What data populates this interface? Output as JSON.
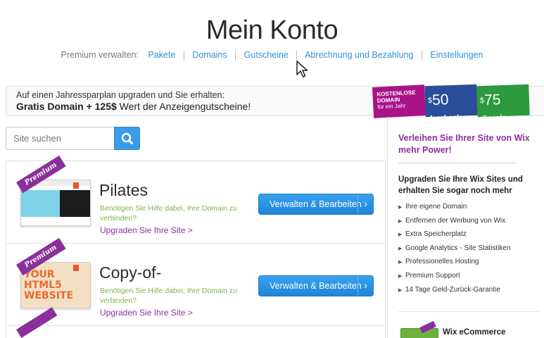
{
  "page": {
    "title": "Mein Konto"
  },
  "subnav": {
    "lead": "Premium verwalten:",
    "items": [
      "Pakete",
      "Domains",
      "Gutscheine",
      "Abrechnung und Bezahlung",
      "Einstellungen"
    ]
  },
  "promo": {
    "line1": "Auf einen Jahressparplan upgraden und Sie erhalten:",
    "line2_bold": "Gratis Domain + 125$",
    "line2_rest": " Wert der Anzeigengutscheine!",
    "badges": {
      "domain": [
        "KOSTENLOSE",
        "DOMAIN",
        "für ein Jahr"
      ],
      "facebook": {
        "amount": "50",
        "brand": "facebook",
        "label": "Ads"
      },
      "google": {
        "amount": "75",
        "brand": "Google",
        "label": "AdWords"
      }
    }
  },
  "search": {
    "placeholder": "Site suchen"
  },
  "sites": [
    {
      "name": "Pilates",
      "help": "Benötigen Sie Hilfe dabei, Ihre Domain zu verbinden?",
      "upgrade": "Upgraden Sie Ihre Site >",
      "button": "Verwalten & Bearbeiten",
      "ribbon": "Premium"
    },
    {
      "name": "Copy-of-",
      "help": "Benötigen Sie Hilfe dabei, Ihre Domain zu verbinden?",
      "upgrade": "Upgraden Sie Ihre Site >",
      "button": "Verwalten & Bearbeiten",
      "ribbon": "Premium",
      "thumb_text": [
        "YOUR",
        "HTML5",
        "WEBSITE"
      ]
    }
  ],
  "sidebar": {
    "title": "Verleihen Sie Ihrer Site von Wix mehr Power!",
    "subtitle": "Upgraden Sie Ihre Wix Sites und erhalten Sie sogar noch mehr",
    "features": [
      "Ihre eigene Domain",
      "Entfernen der Werbung von Wix",
      "Extra Speicherplatz",
      "Google Analytics - Site Statistiken",
      "Professionelles Hosting",
      "Premium Support",
      "14 Tage Geld-Zurück-Garantie"
    ],
    "ecommerce_title": "Wix eCommerce"
  },
  "colors": {
    "link": "#2f8fd8",
    "accent_purple": "#8c2fa0",
    "help_green": "#7ab648",
    "button_blue": "#2b93e3"
  }
}
